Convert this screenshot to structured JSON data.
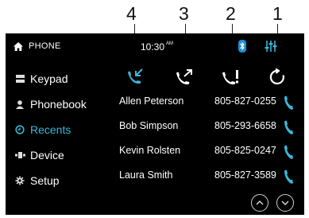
{
  "callouts": [
    "4",
    "3",
    "2",
    "1"
  ],
  "header": {
    "title": "PHONE",
    "time": "10:30",
    "ampm": "AM",
    "home_icon": "home-icon",
    "bluetooth_icon": "bluetooth-icon",
    "settings_icon": "equalizer-icon"
  },
  "sidebar": {
    "items": [
      {
        "label": "Keypad",
        "icon": "keypad-icon",
        "active": false
      },
      {
        "label": "Phonebook",
        "icon": "person-icon",
        "active": false
      },
      {
        "label": "Recents",
        "icon": "recents-icon",
        "active": true
      },
      {
        "label": "Device",
        "icon": "device-icon",
        "active": false
      },
      {
        "label": "Setup",
        "icon": "gear-icon",
        "active": false
      }
    ]
  },
  "filters": [
    {
      "icon": "received-calls-icon",
      "active": true
    },
    {
      "icon": "dialed-calls-icon",
      "active": false
    },
    {
      "icon": "missed-calls-icon",
      "active": false
    },
    {
      "icon": "all-calls-icon",
      "active": false
    }
  ],
  "contacts": [
    {
      "name": "Allen Peterson",
      "number": "805-827-0255"
    },
    {
      "name": "Bob Simpson",
      "number": "805-293-6658"
    },
    {
      "name": "Kevin Rolsten",
      "number": "805-825-0247"
    },
    {
      "name": "Laura Smith",
      "number": "805-827-3589"
    }
  ],
  "pager": {
    "up_icon": "chevron-up-icon",
    "down_icon": "chevron-down-icon"
  },
  "colors": {
    "accent": "#3ab7d8",
    "background": "#000000",
    "text": "#ffffff"
  }
}
